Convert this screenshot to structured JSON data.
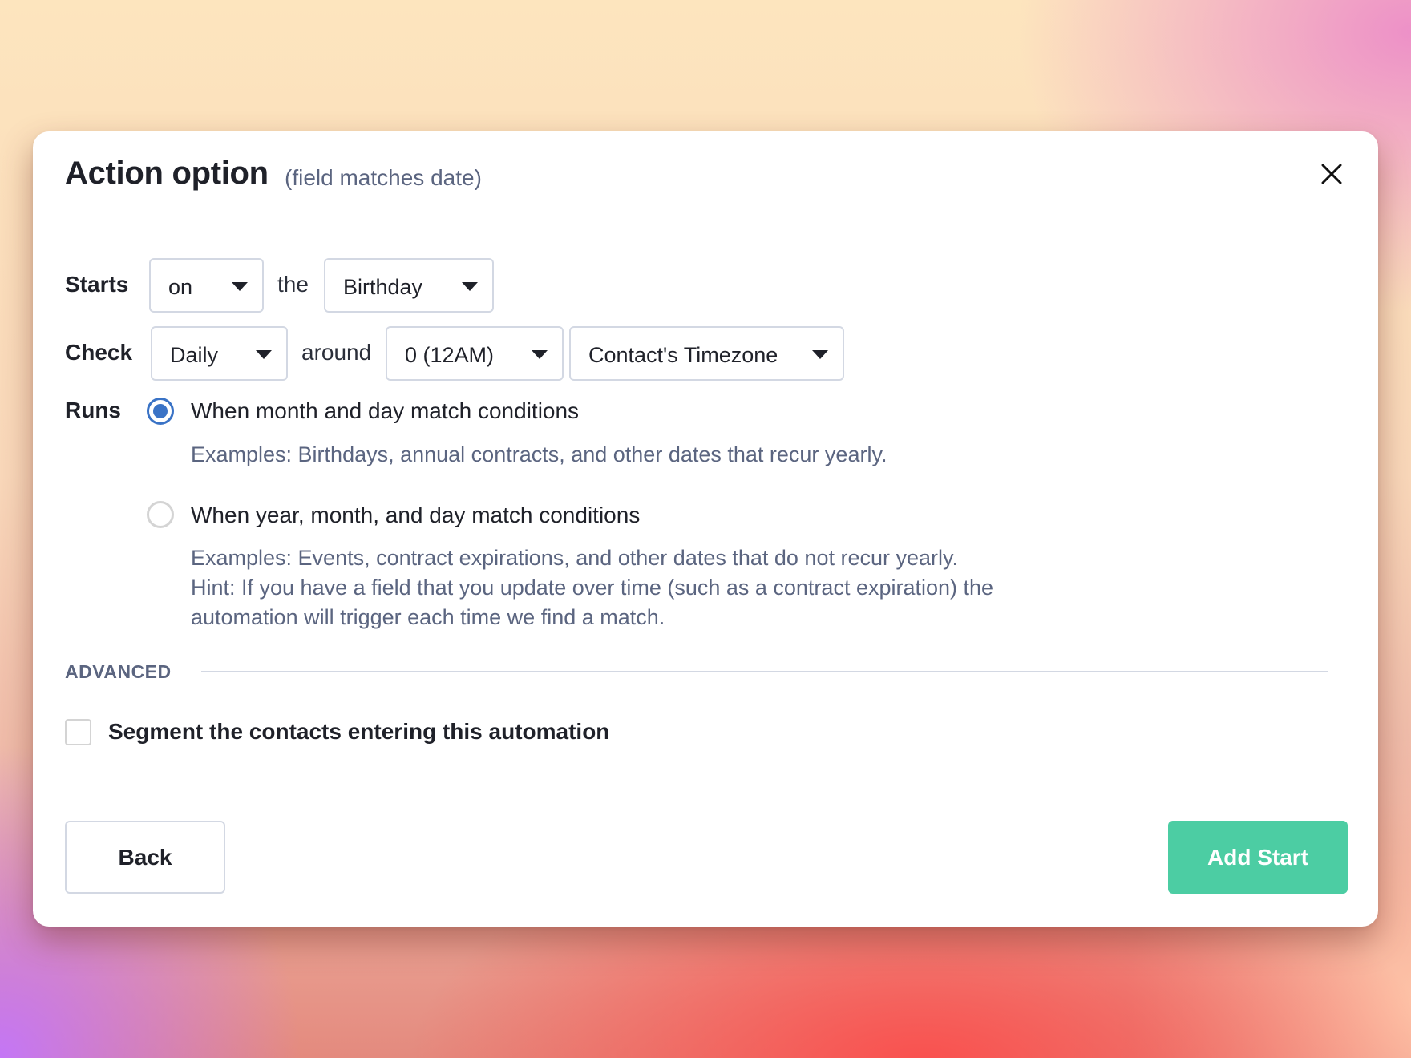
{
  "modal": {
    "title": "Action option",
    "subtitle": "(field matches date)",
    "close_icon": "close-icon"
  },
  "starts": {
    "label": "Starts",
    "qualifier_select": {
      "value": "on"
    },
    "connector": "the",
    "field_select": {
      "value": "Birthday"
    }
  },
  "check": {
    "label": "Check",
    "frequency_select": {
      "value": "Daily"
    },
    "connector": "around",
    "hour_select": {
      "value": "0 (12AM)"
    },
    "timezone_select": {
      "value": "Contact's Timezone"
    }
  },
  "runs": {
    "label": "Runs",
    "options": [
      {
        "label": "When month and day match conditions",
        "selected": true,
        "description": [
          "Examples: Birthdays, annual contracts, and other dates that recur yearly."
        ]
      },
      {
        "label": "When year, month, and day match conditions",
        "selected": false,
        "description": [
          "Examples: Events, contract expirations, and other dates that do not recur yearly.",
          "Hint: If you have a field that you update over time (such as a contract expiration) the",
          "automation will trigger each time we find a match."
        ]
      }
    ]
  },
  "advanced": {
    "heading": "ADVANCED",
    "segment_checkbox": {
      "label": "Segment the contacts entering this automation",
      "checked": false
    }
  },
  "footer": {
    "back_label": "Back",
    "submit_label": "Add Start"
  },
  "colors": {
    "primary": "#4ccda3",
    "radio_accent": "#3a73c6",
    "text": "#1f2129",
    "muted_text": "#5b6580",
    "border": "#d3d8e3"
  }
}
